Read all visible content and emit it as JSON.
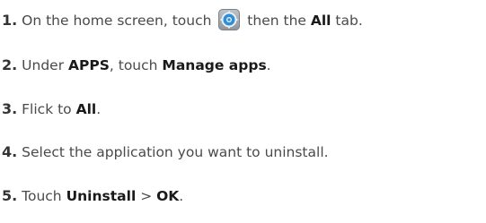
{
  "steps": [
    {
      "number": "1.",
      "parts": {
        "a": " On the home screen, touch ",
        "b": " then the ",
        "c": "All",
        "d": " tab."
      },
      "icon": "settings-gear-icon"
    },
    {
      "number": "2.",
      "parts": {
        "a": " Under ",
        "b": "APPS",
        "c": ", touch ",
        "d": "Manage apps",
        "e": "."
      }
    },
    {
      "number": "3.",
      "parts": {
        "a": " Flick to ",
        "b": "All",
        "c": "."
      }
    },
    {
      "number": "4.",
      "parts": {
        "a": " Select the application you want to uninstall."
      }
    },
    {
      "number": "5.",
      "parts": {
        "a": " Touch ",
        "b": "Uninstall",
        "c": " > ",
        "d": "OK",
        "e": "."
      }
    }
  ],
  "colors": {
    "text": "#4a4a4a",
    "emphasis": "#1a1a1a",
    "icon_blue": "#2f8fd6"
  }
}
